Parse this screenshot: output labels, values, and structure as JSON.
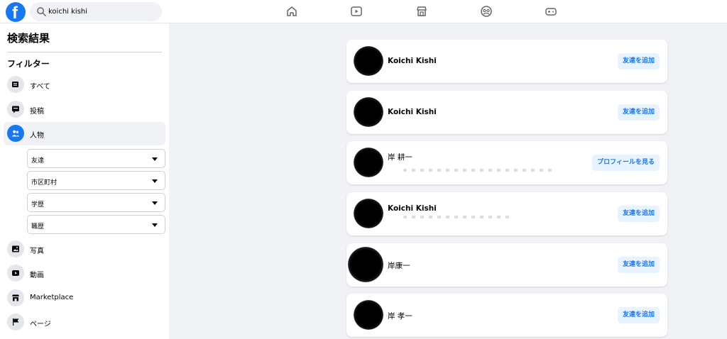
{
  "topbar": {
    "logo": "f",
    "search": {
      "value": "koichi kishi",
      "placeholder": ""
    },
    "nav_icons": [
      "home-icon",
      "watch-icon",
      "marketplace-icon",
      "groups-icon",
      "gaming-icon"
    ]
  },
  "sidebar": {
    "title": "検索結果",
    "filter_heading": "フィルター",
    "items": [
      {
        "label": "すべて",
        "icon": "all-icon"
      },
      {
        "label": "投稿",
        "icon": "posts-icon"
      },
      {
        "label": "人物",
        "icon": "people-icon",
        "active": true
      },
      {
        "label": "写真",
        "icon": "photos-icon"
      },
      {
        "label": "動画",
        "icon": "videos-icon"
      },
      {
        "label": "Marketplace",
        "icon": "marketplace-icon"
      },
      {
        "label": "ページ",
        "icon": "pages-icon"
      }
    ],
    "sub_filters": [
      "友達",
      "市区町村",
      "学歴",
      "職歴"
    ]
  },
  "results": [
    {
      "name": "Koichi Kishi",
      "button": "友達を追加"
    },
    {
      "name": "Koichi Kishi",
      "button": "友達を追加"
    },
    {
      "name": "岸 耕一",
      "button": "プロフィールを見る"
    },
    {
      "name": "Koichi Kishi",
      "button": "友達を追加"
    },
    {
      "name": "岸康一",
      "button": "友達を追加"
    },
    {
      "name": "岸 孝一",
      "button": "友達を追加"
    }
  ],
  "colors": {
    "accent": "#1877f2",
    "button_bg": "#e7f3ff",
    "page_bg": "#f0f2f5"
  }
}
